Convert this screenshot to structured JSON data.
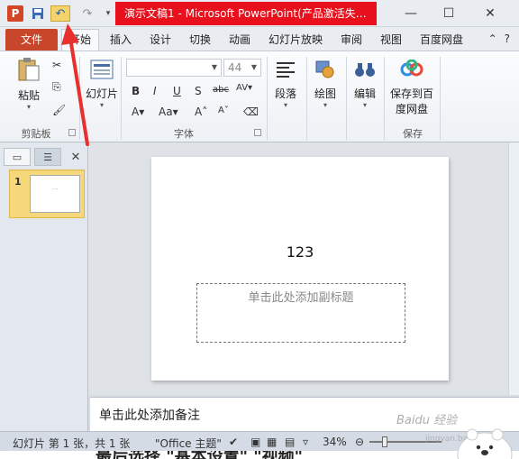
{
  "window": {
    "title": "演示文稿1 - Microsoft PowerPoint(产品激活失…",
    "quick_access": {
      "redo_icon": "redo-icon",
      "more_icon": "customize-quick-access-icon"
    }
  },
  "tabs": {
    "file": "文件",
    "home": "开始",
    "items": [
      "插入",
      "设计",
      "切换",
      "动画",
      "幻灯片放映",
      "审阅",
      "视图",
      "百度网盘"
    ]
  },
  "ribbon": {
    "clipboard": {
      "paste": "粘贴",
      "label": "剪贴板"
    },
    "slides": {
      "new_slide": "幻灯片"
    },
    "font": {
      "size_value": "44",
      "label": "字体"
    },
    "paragraph": {
      "label": "段落"
    },
    "drawing": {
      "label": "绘图"
    },
    "editing": {
      "label": "编辑"
    },
    "save": {
      "button_line1": "保存到百",
      "button_line2": "度网盘",
      "label": "保存"
    }
  },
  "left_pane": {
    "slide_number": "1",
    "thumb_dots": "···"
  },
  "slide": {
    "title_text": "123",
    "subtitle_placeholder": "单击此处添加副标题"
  },
  "notes": {
    "placeholder": "单击此处添加备注"
  },
  "status_bar": {
    "slide_info": "幻灯片 第 1 张，共 1 张",
    "theme": "\"Office 主题\"",
    "zoom": "34%"
  },
  "overlay": {
    "watermark": "Baidu 经验",
    "watermark_sub": "jingyan.baidu.com",
    "bottom_text": "最后选择 \"基本设置\" \"视频\""
  },
  "colors": {
    "file_tab": "#c8472a",
    "title_highlight": "#e8101c",
    "arrow": "#e8312f"
  }
}
